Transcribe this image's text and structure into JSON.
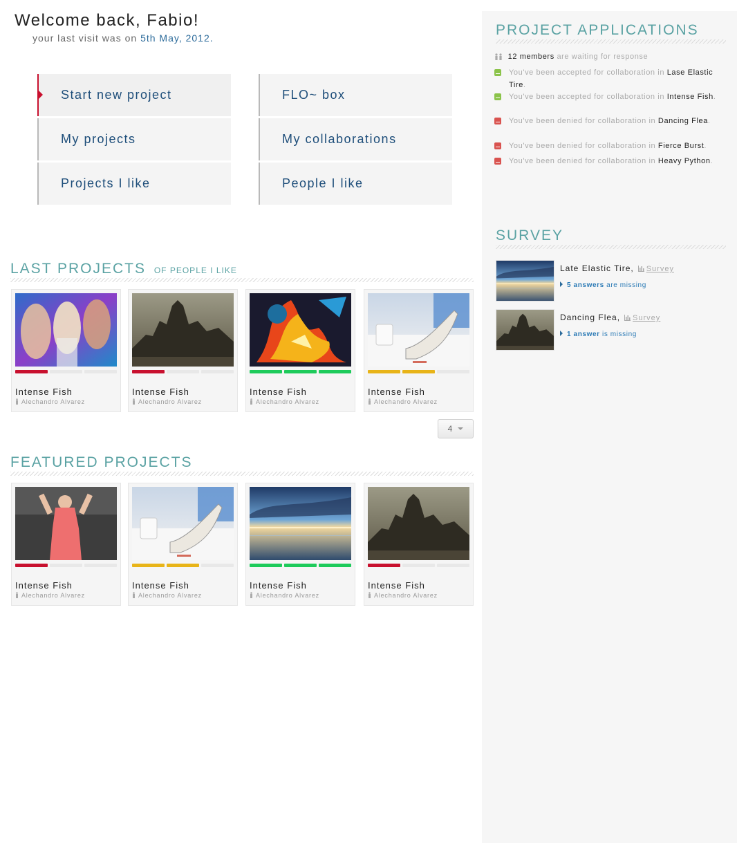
{
  "header": {
    "greeting": "Welcome back, Fabio!",
    "last_visit_prefix": "your last visit was on",
    "last_visit_date": "5th May, 2012."
  },
  "nav": [
    {
      "label": "Start new project",
      "active": true
    },
    {
      "label": "FLO~ box"
    },
    {
      "label": "My projects"
    },
    {
      "label": "My collaborations"
    },
    {
      "label": "Projects I like"
    },
    {
      "label": "People I like"
    }
  ],
  "last_projects": {
    "title": "LAST PROJECTS",
    "subtitle": "OF PEOPLE I LIKE",
    "items": [
      {
        "name": "Intense Fish",
        "author": "Alechandro Alvarez",
        "image": "party-photo",
        "rating": 1,
        "rating_color": "#c8102e"
      },
      {
        "name": "Intense Fish",
        "author": "Alechandro Alvarez",
        "image": "castle-photo",
        "rating": 1,
        "rating_color": "#c8102e"
      },
      {
        "name": "Intense Fish",
        "author": "Alechandro Alvarez",
        "image": "fire-art",
        "rating": 3,
        "rating_color": "#1ecb5b"
      },
      {
        "name": "Intense Fish",
        "author": "Alechandro Alvarez",
        "image": "shoe-photo",
        "rating": 2,
        "rating_color": "#e8b418"
      }
    ],
    "pager_value": "4"
  },
  "featured_projects": {
    "title": "FEATURED PROJECTS",
    "items": [
      {
        "name": "Intense Fish",
        "author": "Alechandro Alvarez",
        "image": "model-photo",
        "rating": 1,
        "rating_color": "#c8102e"
      },
      {
        "name": "Intense Fish",
        "author": "Alechandro Alvarez",
        "image": "shoe-photo",
        "rating": 2,
        "rating_color": "#e8b418"
      },
      {
        "name": "Intense Fish",
        "author": "Alechandro Alvarez",
        "image": "seascape-photo",
        "rating": 3,
        "rating_color": "#1ecb5b"
      },
      {
        "name": "Intense Fish",
        "author": "Alechandro Alvarez",
        "image": "castle-photo",
        "rating": 1,
        "rating_color": "#c8102e"
      }
    ]
  },
  "applications": {
    "title": "PROJECT APPLICATIONS",
    "members_count": "12 members",
    "members_text": "are waiting for response",
    "items": [
      {
        "status": "accepted",
        "text": "You've been accepted for collaboration in",
        "project": "Lase Elastic Tire"
      },
      {
        "status": "accepted",
        "text": "You've been accepted for collaboration in",
        "project": "Intense Fish"
      },
      {
        "status": "denied",
        "text": "You've been denied for collaboration in",
        "project": "Dancing Flea"
      },
      {
        "status": "denied",
        "text": "You've been denied for collaboration in",
        "project": "Fierce Burst"
      },
      {
        "status": "denied",
        "text": "You've been denied for collaboration in",
        "project": "Heavy Python"
      }
    ]
  },
  "survey": {
    "title": "SURVEY",
    "link_label": "Survey",
    "items": [
      {
        "project": "Late Elastic Tire,",
        "image": "seascape-photo",
        "missing_count": "5 answers",
        "missing_text": "are missing"
      },
      {
        "project": "Dancing Flea,",
        "image": "castle-photo",
        "missing_count": "1 answer",
        "missing_text": "is missing"
      }
    ]
  }
}
